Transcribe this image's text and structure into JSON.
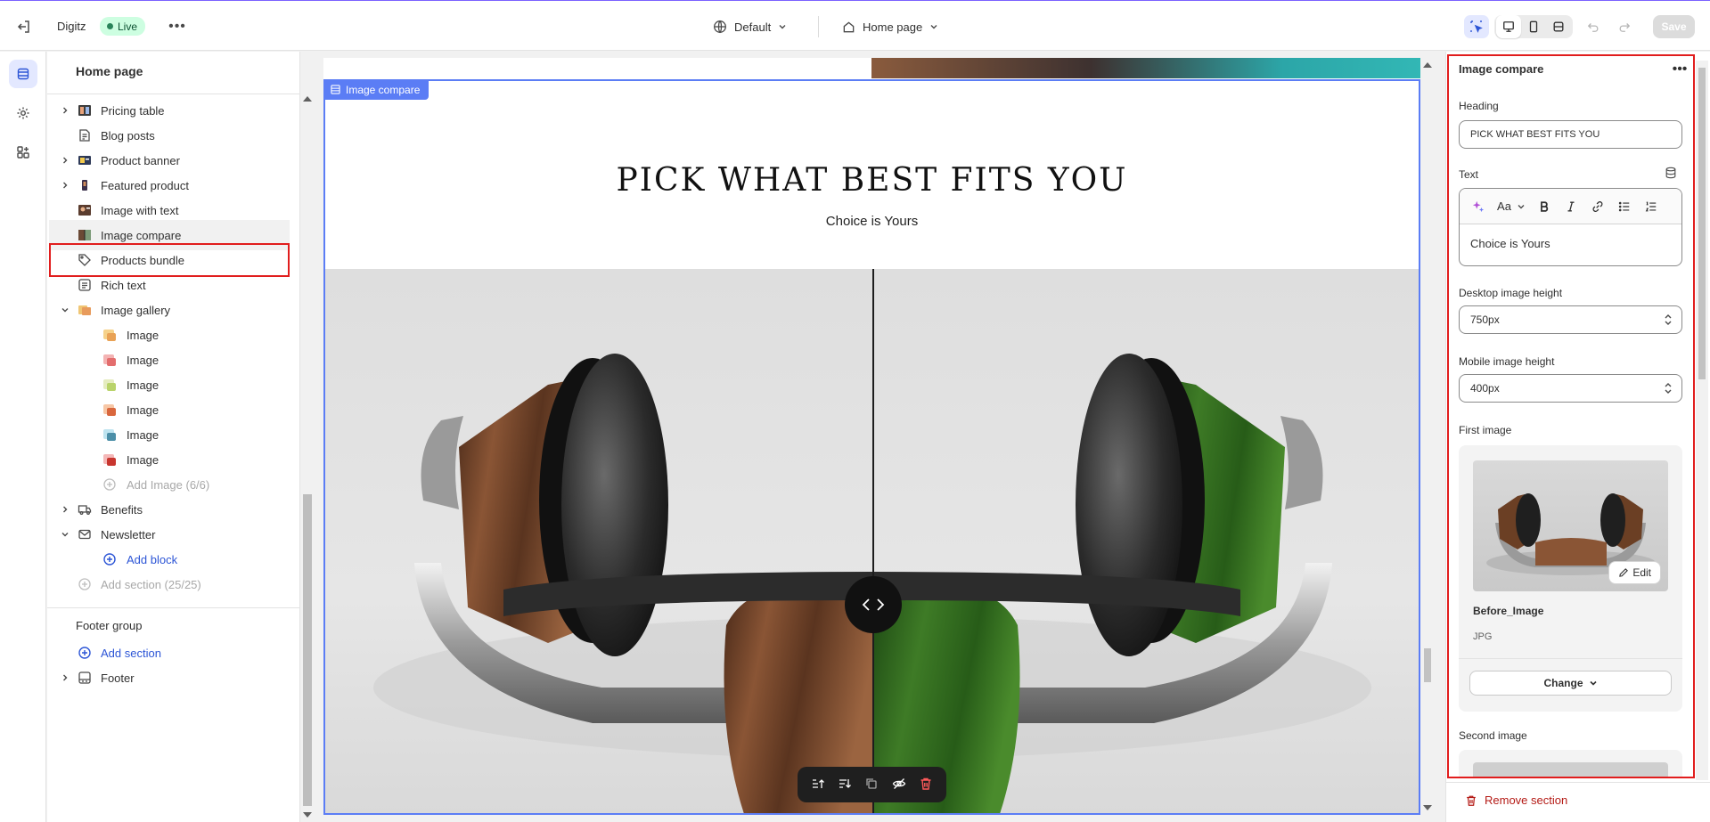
{
  "topbar": {
    "store_name": "Digitz",
    "status_badge": "Live",
    "theme_selector": "Default",
    "page_selector": "Home page",
    "save_label": "Save"
  },
  "sidebar": {
    "title": "Home page",
    "items": [
      {
        "label": "Pricing table",
        "expandable": true,
        "icon": "pricing-table-icon"
      },
      {
        "label": "Blog posts",
        "expandable": false,
        "icon": "blog-icon"
      },
      {
        "label": "Product banner",
        "expandable": true,
        "icon": "product-banner-icon"
      },
      {
        "label": "Featured product",
        "expandable": true,
        "icon": "featured-product-icon"
      },
      {
        "label": "Image with text",
        "expandable": false,
        "icon": "image-with-text-icon"
      },
      {
        "label": "Image compare",
        "expandable": false,
        "icon": "image-compare-icon",
        "selected": true
      },
      {
        "label": "Products bundle",
        "expandable": false,
        "icon": "tag-icon"
      },
      {
        "label": "Rich text",
        "expandable": false,
        "icon": "rich-text-icon"
      },
      {
        "label": "Image gallery",
        "expandable": true,
        "expanded": true,
        "icon": "image-gallery-icon"
      }
    ],
    "gallery_children": [
      "Image",
      "Image",
      "Image",
      "Image",
      "Image",
      "Image"
    ],
    "add_image": "Add Image (6/6)",
    "benefits": "Benefits",
    "newsletter": "Newsletter",
    "add_block": "Add block",
    "add_section_disabled": "Add section (25/25)",
    "footer_group": "Footer group",
    "add_section": "Add section",
    "footer": "Footer"
  },
  "preview": {
    "section_tag": "Image compare",
    "heading": "PICK WHAT BEST FITS YOU",
    "text": "Choice is Yours"
  },
  "settings": {
    "title": "Image compare",
    "heading_label": "Heading",
    "heading_value": "PICK WHAT BEST FITS YOU",
    "text_label": "Text",
    "text_value": "Choice is Yours",
    "desktop_height_label": "Desktop image height",
    "desktop_height_value": "750px",
    "mobile_height_label": "Mobile image height",
    "mobile_height_value": "400px",
    "first_image_label": "First image",
    "first_image_name": "Before_Image",
    "first_image_type": "JPG",
    "edit_label": "Edit",
    "change_label": "Change",
    "second_image_label": "Second image",
    "remove_section": "Remove section"
  },
  "colors": {
    "accent": "#2c55d6",
    "frame_blue": "#5b7df5",
    "highlight_red": "#e11d1d",
    "live_green": "#29845a",
    "danger": "#b41a15"
  }
}
